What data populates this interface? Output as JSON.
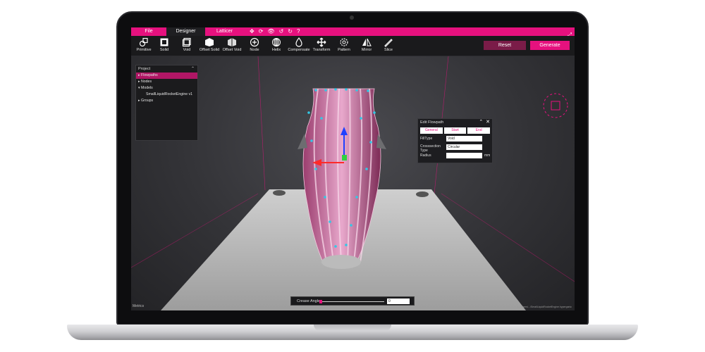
{
  "menubar": {
    "tabs": [
      "File",
      "Designer",
      "Latticer"
    ],
    "icons": [
      "move-icon",
      "sync-icon",
      "eye-icon",
      "undo-icon",
      "redo-icon",
      "help-icon",
      "fullscreen-icon"
    ]
  },
  "toolbar": {
    "tools": [
      {
        "label": "Primitive",
        "icon": "primitive-icon"
      },
      {
        "label": "Solid",
        "icon": "solid-icon"
      },
      {
        "label": "Void",
        "icon": "void-icon"
      },
      {
        "label": "Offset Solid",
        "icon": "offset-solid-icon"
      },
      {
        "label": "Offset Void",
        "icon": "offset-void-icon"
      },
      {
        "label": "Node",
        "icon": "node-icon"
      },
      {
        "label": "Helix",
        "icon": "helix-icon"
      },
      {
        "label": "Compensate",
        "icon": "compensate-icon"
      },
      {
        "label": "Transform",
        "icon": "transform-icon"
      },
      {
        "label": "Pattern",
        "icon": "pattern-icon"
      },
      {
        "label": "Mirror",
        "icon": "mirror-icon"
      },
      {
        "label": "Slice",
        "icon": "slice-icon"
      }
    ],
    "reset_label": "Reset",
    "generate_label": "Generate"
  },
  "project": {
    "title": "Project",
    "items": [
      {
        "label": "▸ Flowpaths",
        "selected": true
      },
      {
        "label": "▸ Nodes"
      },
      {
        "label": "▾ Models"
      },
      {
        "label": "SmallLiquidRocketEngine v1"
      },
      {
        "label": "▸ Groups"
      }
    ]
  },
  "edit_flowpath": {
    "title": "Edit Flowpath",
    "tabs": [
      "General",
      "Start",
      "End"
    ],
    "fill_type_label": "FillType",
    "fill_type_value": "Void",
    "cross_section_label": "Crosssection Type",
    "cross_section_value": "Circular",
    "radius_label": "Radius",
    "radius_value": "",
    "radius_unit": "mm"
  },
  "crease": {
    "label": "Crease Angle",
    "value": "0",
    "slider_fraction": 0.0
  },
  "footer": {
    "metrics_label": "Metrics",
    "path_text": "C:/Users/.../SmallLiquidRocketEngine.hyperganic"
  },
  "colors": {
    "accent": "#e6117e",
    "toolbar_bg": "#1a1a1c"
  }
}
